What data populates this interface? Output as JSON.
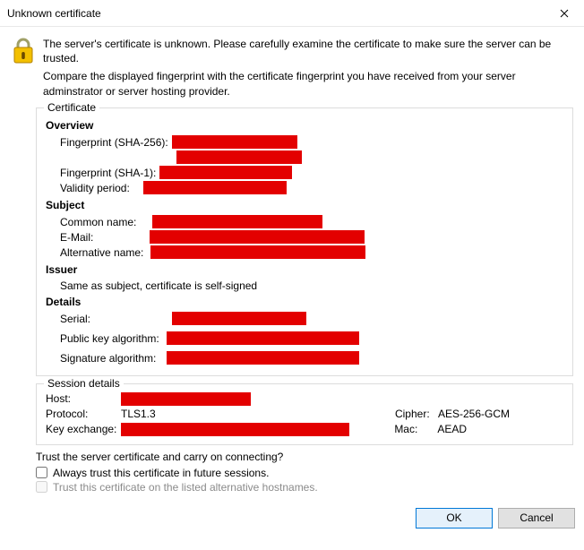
{
  "window": {
    "title": "Unknown certificate"
  },
  "warning": {
    "line1": "The server's certificate is unknown. Please carefully examine the certificate to make sure the server can be trusted.",
    "line2": "Compare the displayed fingerprint with the certificate fingerprint you have received from your server adminstrator or server hosting provider."
  },
  "certificate": {
    "legend": "Certificate",
    "overview": {
      "heading": "Overview",
      "fingerprint_sha256_label": "Fingerprint (SHA-256):",
      "fingerprint_sha1_label": "Fingerprint (SHA-1):",
      "validity_label": "Validity period:"
    },
    "subject": {
      "heading": "Subject",
      "common_name_label": "Common name:",
      "email_label": "E-Mail:",
      "altname_label": "Alternative name:"
    },
    "issuer": {
      "heading": "Issuer",
      "note": "Same as subject, certificate is self-signed"
    },
    "details": {
      "heading": "Details",
      "serial_label": "Serial:",
      "pubkey_label": "Public key algorithm:",
      "sigalg_label": "Signature algorithm:"
    }
  },
  "session": {
    "legend": "Session details",
    "host_label": "Host:",
    "protocol_label": "Protocol:",
    "protocol_value": "TLS1.3",
    "keyexchange_label": "Key exchange:",
    "cipher_label": "Cipher:",
    "cipher_value": "AES-256-GCM",
    "mac_label": "Mac:",
    "mac_value": "AEAD"
  },
  "trust": {
    "question": "Trust the server certificate and carry on connecting?",
    "always_label": "Always trust this certificate in future sessions.",
    "altnames_label": "Trust this certificate on the listed alternative hostnames."
  },
  "buttons": {
    "ok": "OK",
    "cancel": "Cancel"
  }
}
